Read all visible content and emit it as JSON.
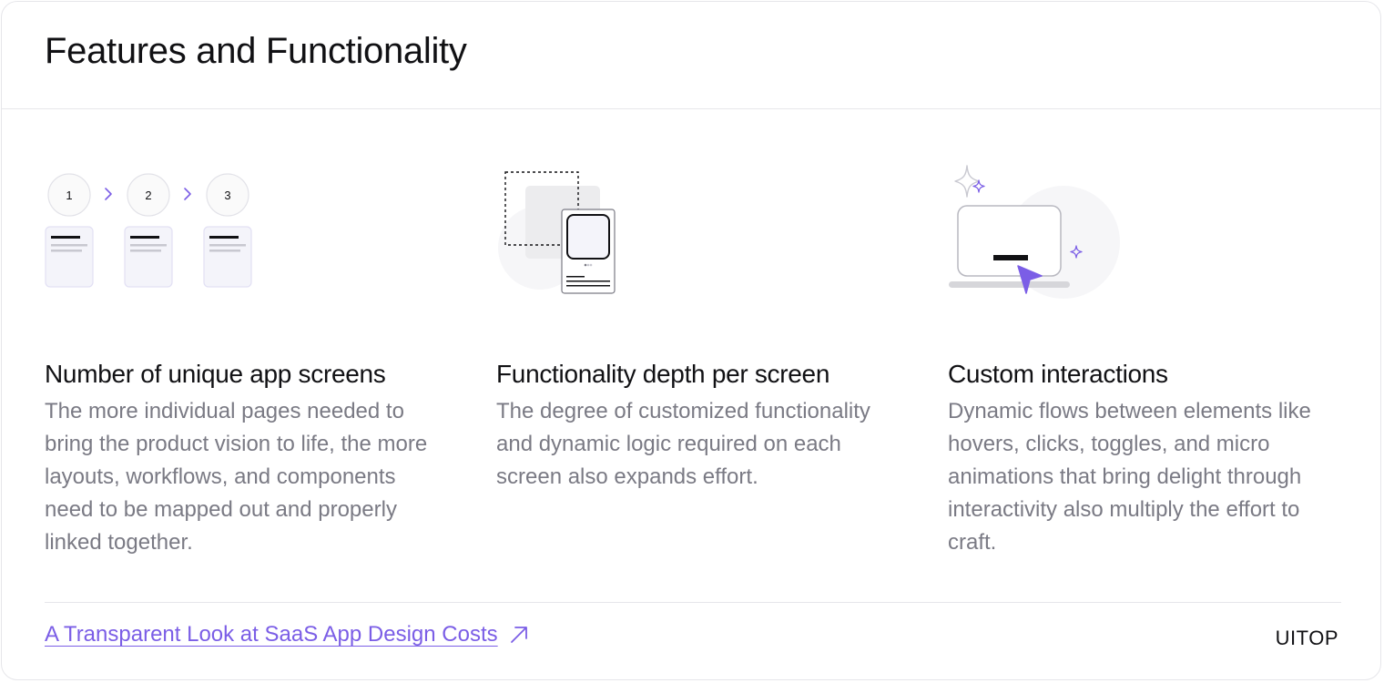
{
  "header": {
    "title": "Features and Functionality"
  },
  "features": [
    {
      "title": "Number of unique app screens",
      "description": "The more individual pages needed to bring the product vision to life, the more layouts, workflows, and components need to be mapped out and properly linked together.",
      "illustration": {
        "steps": [
          "1",
          "2",
          "3"
        ],
        "icon": "screens-flow-icon"
      }
    },
    {
      "title": "Functionality depth per screen",
      "description": "The degree of customized functionality and dynamic logic required on each screen also expands effort.",
      "illustration": {
        "icon": "screen-depth-icon"
      }
    },
    {
      "title": "Custom interactions",
      "description": "Dynamic flows between elements like hovers, clicks, toggles, and micro animations that bring delight through interactivity also multiply the effort to craft.",
      "illustration": {
        "icon": "cursor-interaction-icon"
      }
    }
  ],
  "footer": {
    "link_text": "A Transparent Look at SaaS App Design Costs",
    "link_icon": "arrow-up-right-icon",
    "brand": "UITOP"
  },
  "colors": {
    "accent": "#7b5ee6",
    "text_primary": "#111114",
    "text_secondary": "#7a7a84",
    "border": "#e6e6ea",
    "card_fill": "#f4f4fa"
  }
}
